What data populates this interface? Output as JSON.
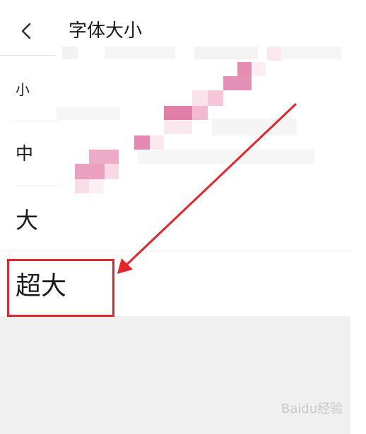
{
  "header": {
    "back_icon": "chevron-left-icon",
    "title": "字体大小"
  },
  "font_sizes": [
    {
      "label": "小"
    },
    {
      "label": "中"
    },
    {
      "label": "大"
    },
    {
      "label": "超大"
    }
  ],
  "annotation": {
    "color": "#e5242b",
    "highlighted_option": "超大"
  },
  "watermark": {
    "text": "Baidu经验",
    "color": "#c8c8c8"
  },
  "colors": {
    "background": "#ffffff",
    "empty_area": "#f0f0f0",
    "mosaic": "#e08ab0",
    "text": "#1a1a1a"
  }
}
